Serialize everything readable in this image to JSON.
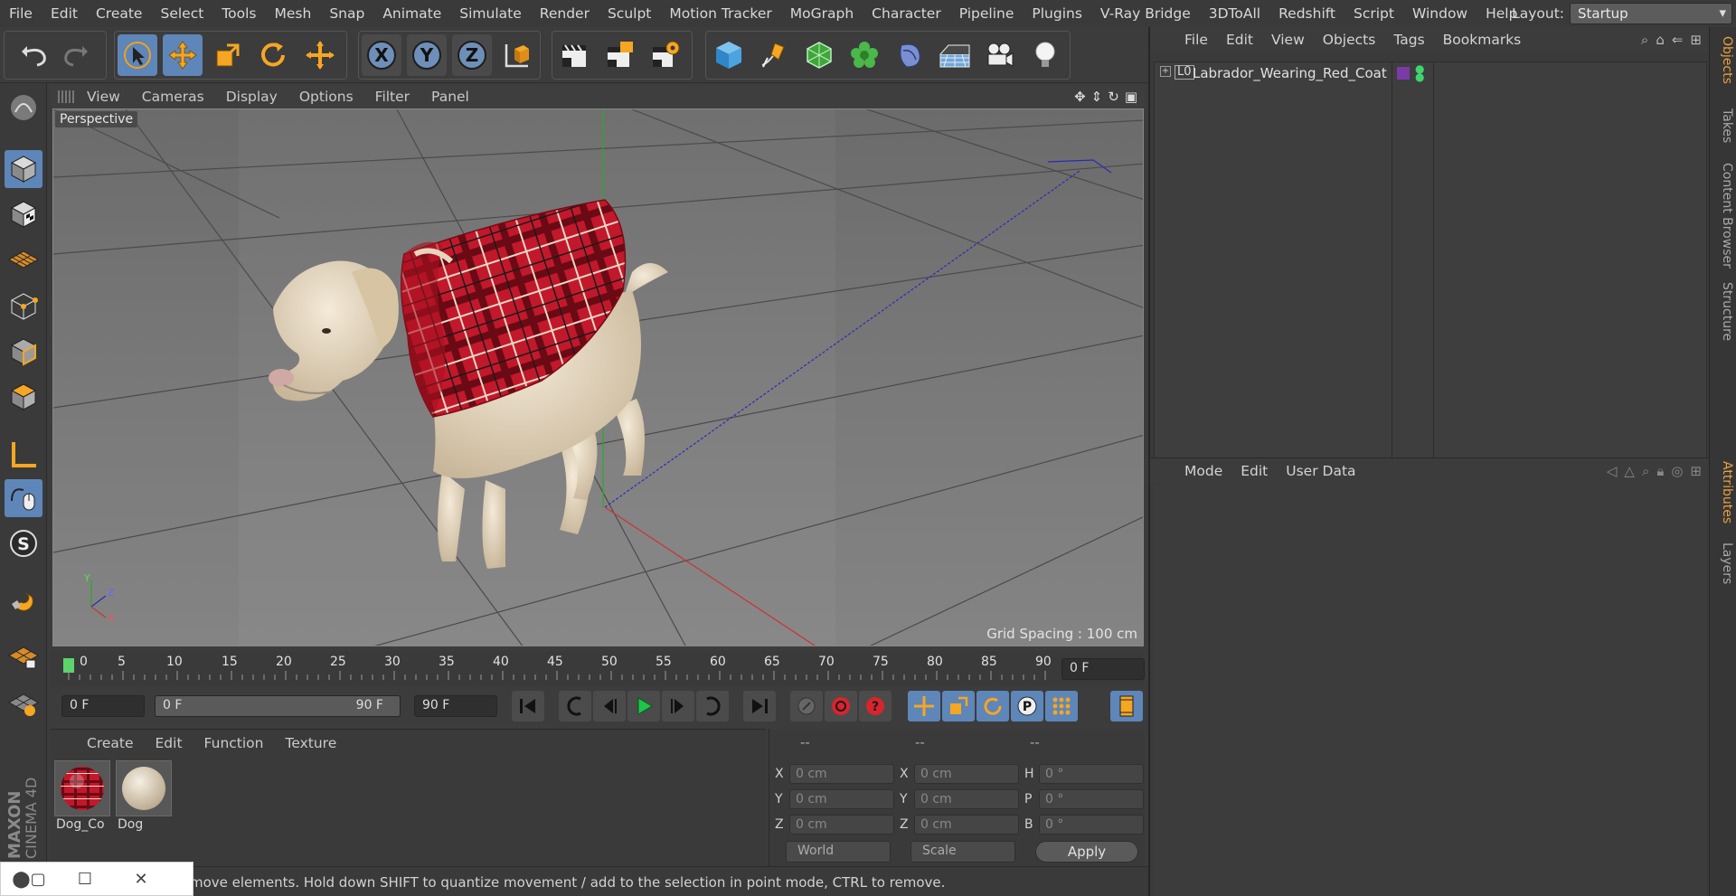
{
  "menubar": {
    "items": [
      "File",
      "Edit",
      "Create",
      "Select",
      "Tools",
      "Mesh",
      "Snap",
      "Animate",
      "Simulate",
      "Render",
      "Sculpt",
      "Motion Tracker",
      "MoGraph",
      "Character",
      "Pipeline",
      "Plugins",
      "V-Ray Bridge",
      "3DToAll",
      "Redshift",
      "Script",
      "Window",
      "Help"
    ],
    "layout_label": "Layout:",
    "layout_value": "Startup"
  },
  "toolbar": {
    "icons": [
      "undo-icon",
      "redo-icon",
      "live-selection-icon",
      "move-icon",
      "scale-icon",
      "rotate-icon",
      "transform-icon",
      "x-axis-icon",
      "y-axis-icon",
      "z-axis-icon",
      "world-coordinate-icon",
      "render-view-icon",
      "render-picture-viewer-icon",
      "render-settings-icon",
      "cube-icon",
      "pen-icon",
      "subdivision-icon",
      "cloner-icon",
      "deformer-icon",
      "floor-icon",
      "camera-icon",
      "light-icon"
    ],
    "axis": [
      "X",
      "Y",
      "Z"
    ]
  },
  "viewport": {
    "menu": [
      "View",
      "Cameras",
      "Display",
      "Options",
      "Filter",
      "Panel"
    ],
    "label": "Perspective",
    "grid_spacing": "Grid Spacing : 100 cm"
  },
  "timeline": {
    "ticks": [
      "0",
      "5",
      "10",
      "15",
      "20",
      "25",
      "30",
      "35",
      "40",
      "45",
      "50",
      "55",
      "60",
      "65",
      "70",
      "75",
      "80",
      "85",
      "90"
    ],
    "current_frame": "0 F"
  },
  "transport": {
    "start": "0 F",
    "range_start": "0 F",
    "range_end": "90 F",
    "end": "90 F"
  },
  "materials": {
    "menu": [
      "Create",
      "Edit",
      "Function",
      "Texture"
    ],
    "items": [
      {
        "name": "Dog_Co"
      },
      {
        "name": "Dog"
      }
    ]
  },
  "coords": {
    "headers": [
      "--",
      "--",
      "--"
    ],
    "rows": [
      {
        "a": "X",
        "av": "0 cm",
        "b": "X",
        "bv": "0 cm",
        "c": "H",
        "cv": "0 °"
      },
      {
        "a": "Y",
        "av": "0 cm",
        "b": "Y",
        "bv": "0 cm",
        "c": "P",
        "cv": "0 °"
      },
      {
        "a": "Z",
        "av": "0 cm",
        "b": "Z",
        "bv": "0 cm",
        "c": "B",
        "cv": "0 °"
      }
    ],
    "mode1": "World",
    "mode2": "Scale",
    "apply": "Apply"
  },
  "status": {
    "text": "move elements. Hold down SHIFT to quantize movement / add to the selection in point mode, CTRL to remove."
  },
  "objects": {
    "menu": [
      "File",
      "Edit",
      "View",
      "Objects",
      "Tags",
      "Bookmarks"
    ],
    "items": [
      {
        "name": "Labrador_Wearing_Red_Coat"
      }
    ],
    "tag_color": "#7a3aa8"
  },
  "attributes": {
    "menu": [
      "Mode",
      "Edit",
      "User Data"
    ]
  },
  "sidetabs": [
    "Objects",
    "Takes",
    "Content Browser",
    "Structure",
    "Attributes",
    "Layers"
  ],
  "logo": {
    "brand": "MAXON",
    "product": "CINEMA 4D"
  },
  "colors": {
    "accent": "#5e86b8",
    "active_tab": "#e8a040",
    "timeline_marker": "#5cd46c"
  }
}
